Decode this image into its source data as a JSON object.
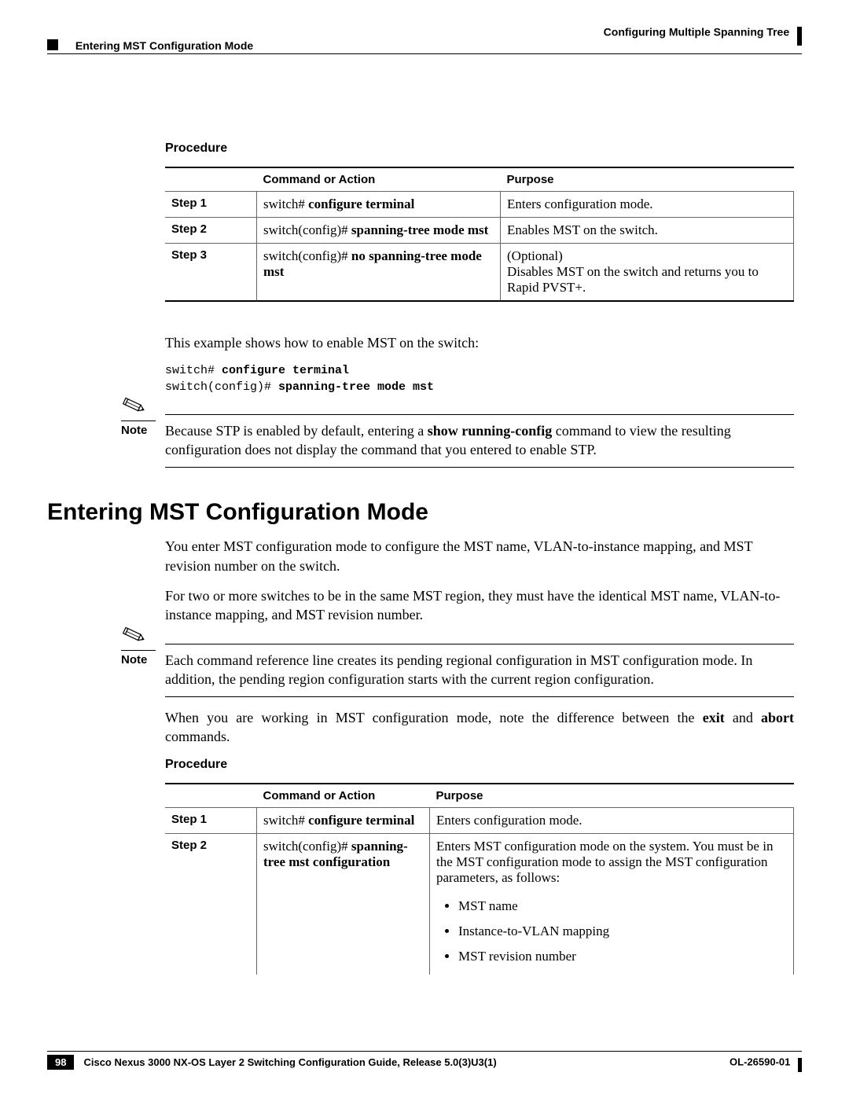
{
  "header": {
    "right_text": "Configuring Multiple Spanning Tree",
    "left_text": "Entering MST Configuration Mode"
  },
  "proc1": {
    "heading": "Procedure",
    "col_command": "Command or Action",
    "col_purpose": "Purpose",
    "rows": [
      {
        "step": "Step 1",
        "cmd_prefix": "switch# ",
        "cmd_bold": "configure terminal",
        "purpose": "Enters configuration mode."
      },
      {
        "step": "Step 2",
        "cmd_prefix": "switch(config)# ",
        "cmd_bold": "spanning-tree mode mst",
        "purpose": "Enables MST on the switch."
      },
      {
        "step": "Step 3",
        "cmd_prefix": "switch(config)# ",
        "cmd_bold": "no spanning-tree mode mst",
        "purpose_line1": "(Optional)",
        "purpose_line2": "Disables MST on the switch and returns you to Rapid PVST+."
      }
    ]
  },
  "example_intro": "This example shows how to enable MST on the switch:",
  "code": {
    "line1_prefix": "switch# ",
    "line1_bold": "configure terminal",
    "line2_prefix": "switch(config)# ",
    "line2_bold": "spanning-tree mode mst"
  },
  "note1": {
    "label": "Note",
    "text_before": "Because STP is enabled by default, entering a ",
    "bold": "show running-config",
    "text_after": " command to view the resulting configuration does not display the command that you entered to enable STP."
  },
  "section_title": "Entering MST Configuration Mode",
  "para1": "You enter MST configuration mode to configure the MST name, VLAN-to-instance mapping, and MST revision number on the switch.",
  "para2": "For two or more switches to be in the same MST region, they must have the identical MST name, VLAN-to-instance mapping, and MST revision number.",
  "note2": {
    "label": "Note",
    "text": "Each command reference line creates its pending regional configuration in MST configuration mode. In addition, the pending region configuration starts with the current region configuration."
  },
  "para3": {
    "pre": "When you are working in MST configuration mode, note the difference between the ",
    "b1": "exit",
    "mid": " and ",
    "b2": "abort",
    "post": " commands."
  },
  "proc2": {
    "heading": "Procedure",
    "col_command": "Command or Action",
    "col_purpose": "Purpose",
    "rows": [
      {
        "step": "Step 1",
        "cmd_prefix": "switch# ",
        "cmd_bold": "configure terminal",
        "purpose": "Enters configuration mode."
      },
      {
        "step": "Step 2",
        "cmd_prefix": "switch(config)# ",
        "cmd_bold": "spanning-tree mst configuration",
        "purpose_intro": "Enters MST configuration mode on the system. You must be in the MST configuration mode to assign the MST configuration parameters, as follows:",
        "bullets": [
          "MST name",
          "Instance-to-VLAN mapping",
          "MST revision number"
        ]
      }
    ]
  },
  "footer": {
    "title": "Cisco Nexus 3000 NX-OS Layer 2 Switching Configuration Guide, Release 5.0(3)U3(1)",
    "page": "98",
    "doc": "OL-26590-01"
  }
}
